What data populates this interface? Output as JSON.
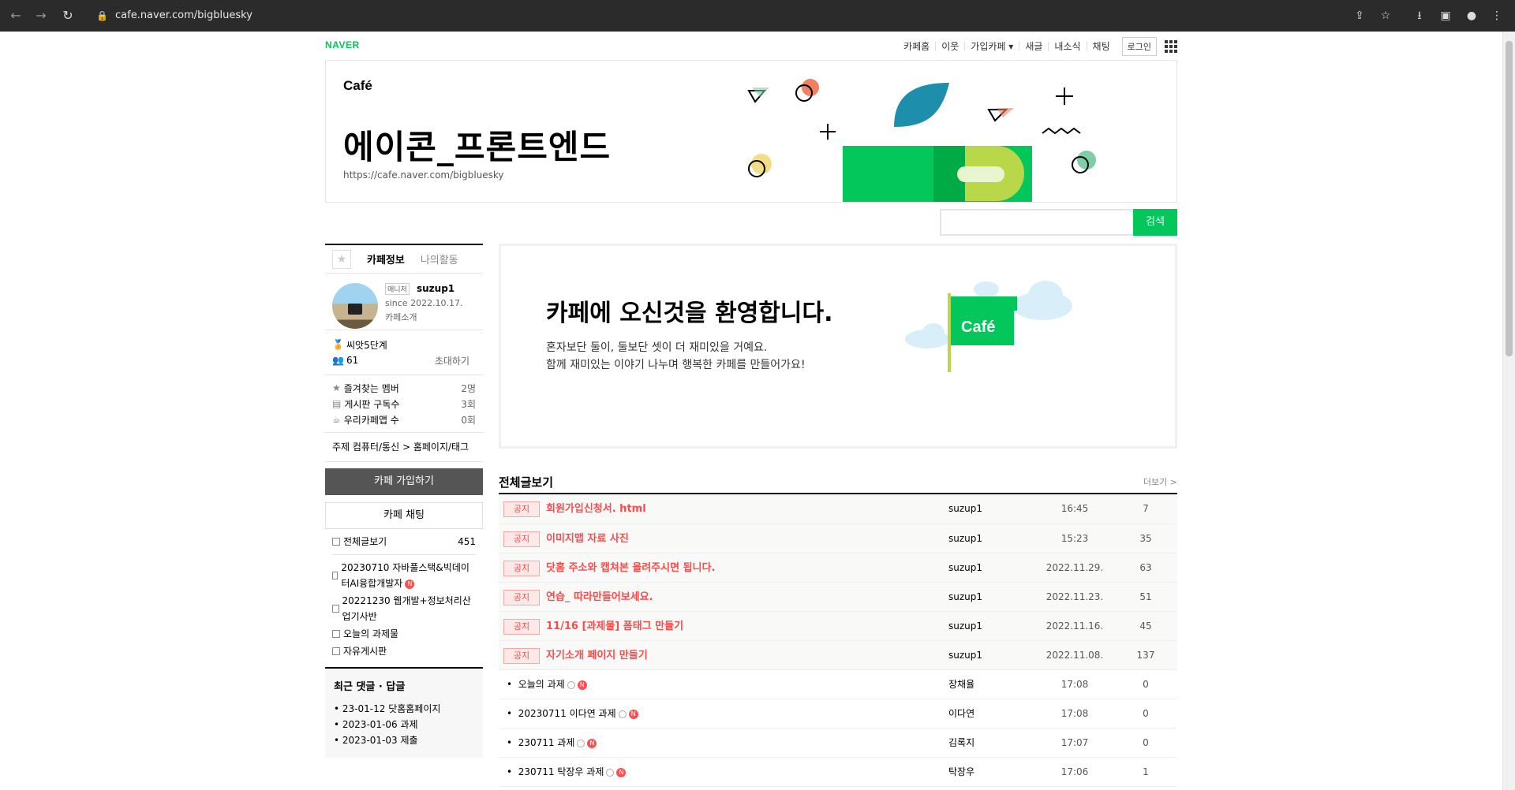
{
  "browser": {
    "url": "cafe.naver.com/bigbluesky"
  },
  "gnb": {
    "brand": "NAVER",
    "items": [
      "카페홈",
      "이웃",
      "가입카페",
      "새글",
      "내소식",
      "채팅"
    ],
    "login": "로그인"
  },
  "header": {
    "logo": "Café",
    "title": "에이콘_프론트엔드",
    "url": "https://cafe.naver.com/bigbluesky"
  },
  "search": {
    "button": "검색"
  },
  "sidebar": {
    "tab_info": "카페정보",
    "tab_activity": "나의활동",
    "manager_label": "매니저",
    "username": "suzup1",
    "since": "since 2022.10.17.",
    "intro": "카페소개",
    "level": "씨앗5단계",
    "members": "61",
    "invite": "초대하기",
    "stats": [
      {
        "label": "즐겨찾는 멤버",
        "value": "2명"
      },
      {
        "label": "게시판 구독수",
        "value": "3회"
      },
      {
        "label": "우리카페앱 수",
        "value": "0회"
      }
    ],
    "topic": "주제  컴퓨터/통신 > 홈페이지/태그",
    "join": "카페 가입하기",
    "chat": "카페 채팅",
    "all_posts": "전체글보기",
    "all_count": "451",
    "boards": [
      "20230710 자바풀스택&빅데이터AI융합개발자",
      "20221230 웹개발+정보처리산업기사반",
      "오늘의 과제물",
      "자유게시판"
    ],
    "recent_title": "최근 댓글 · 답글",
    "recent": [
      "23-01-12 닷홈홈페이지",
      "2023-01-06 과제",
      "2023-01-03 제출"
    ]
  },
  "welcome": {
    "title": "카페에 오신것을 환영합니다.",
    "line1": "혼자보단 둘이, 둘보단 셋이 더 재미있을 거예요.",
    "line2": "함께 재미있는 이야기 나누며 행복한 카페를 만들어가요!",
    "flag": "Café"
  },
  "board": {
    "title": "전체글보기",
    "more": "더보기 >",
    "notice_tag": "공지",
    "notices": [
      {
        "title": "회원가입신청서. html",
        "author": "suzup1",
        "date": "16:45",
        "views": "7"
      },
      {
        "title": "이미지맵 자료 사진",
        "author": "suzup1",
        "date": "15:23",
        "views": "35"
      },
      {
        "title": "닷홈 주소와 캡쳐본 올려주시면 됩니다.",
        "author": "suzup1",
        "date": "2022.11.29.",
        "views": "63"
      },
      {
        "title": "연습_ 따라만들어보세요.",
        "author": "suzup1",
        "date": "2022.11.23.",
        "views": "51"
      },
      {
        "title": "11/16 [과제물] 폼태그 만들기",
        "author": "suzup1",
        "date": "2022.11.16.",
        "views": "45"
      },
      {
        "title": "자기소개 페이지 만들기",
        "author": "suzup1",
        "date": "2022.11.08.",
        "views": "137"
      }
    ],
    "posts": [
      {
        "title": "오늘의 과제",
        "author": "장채율",
        "date": "17:08",
        "views": "0"
      },
      {
        "title": "20230711 이다연 과제",
        "author": "이다연",
        "date": "17:08",
        "views": "0"
      },
      {
        "title": "230711 과제",
        "author": "김록지",
        "date": "17:07",
        "views": "0"
      },
      {
        "title": "230711 탁장우 과제",
        "author": "탁장우",
        "date": "17:06",
        "views": "1"
      }
    ],
    "new_badge": "N"
  }
}
